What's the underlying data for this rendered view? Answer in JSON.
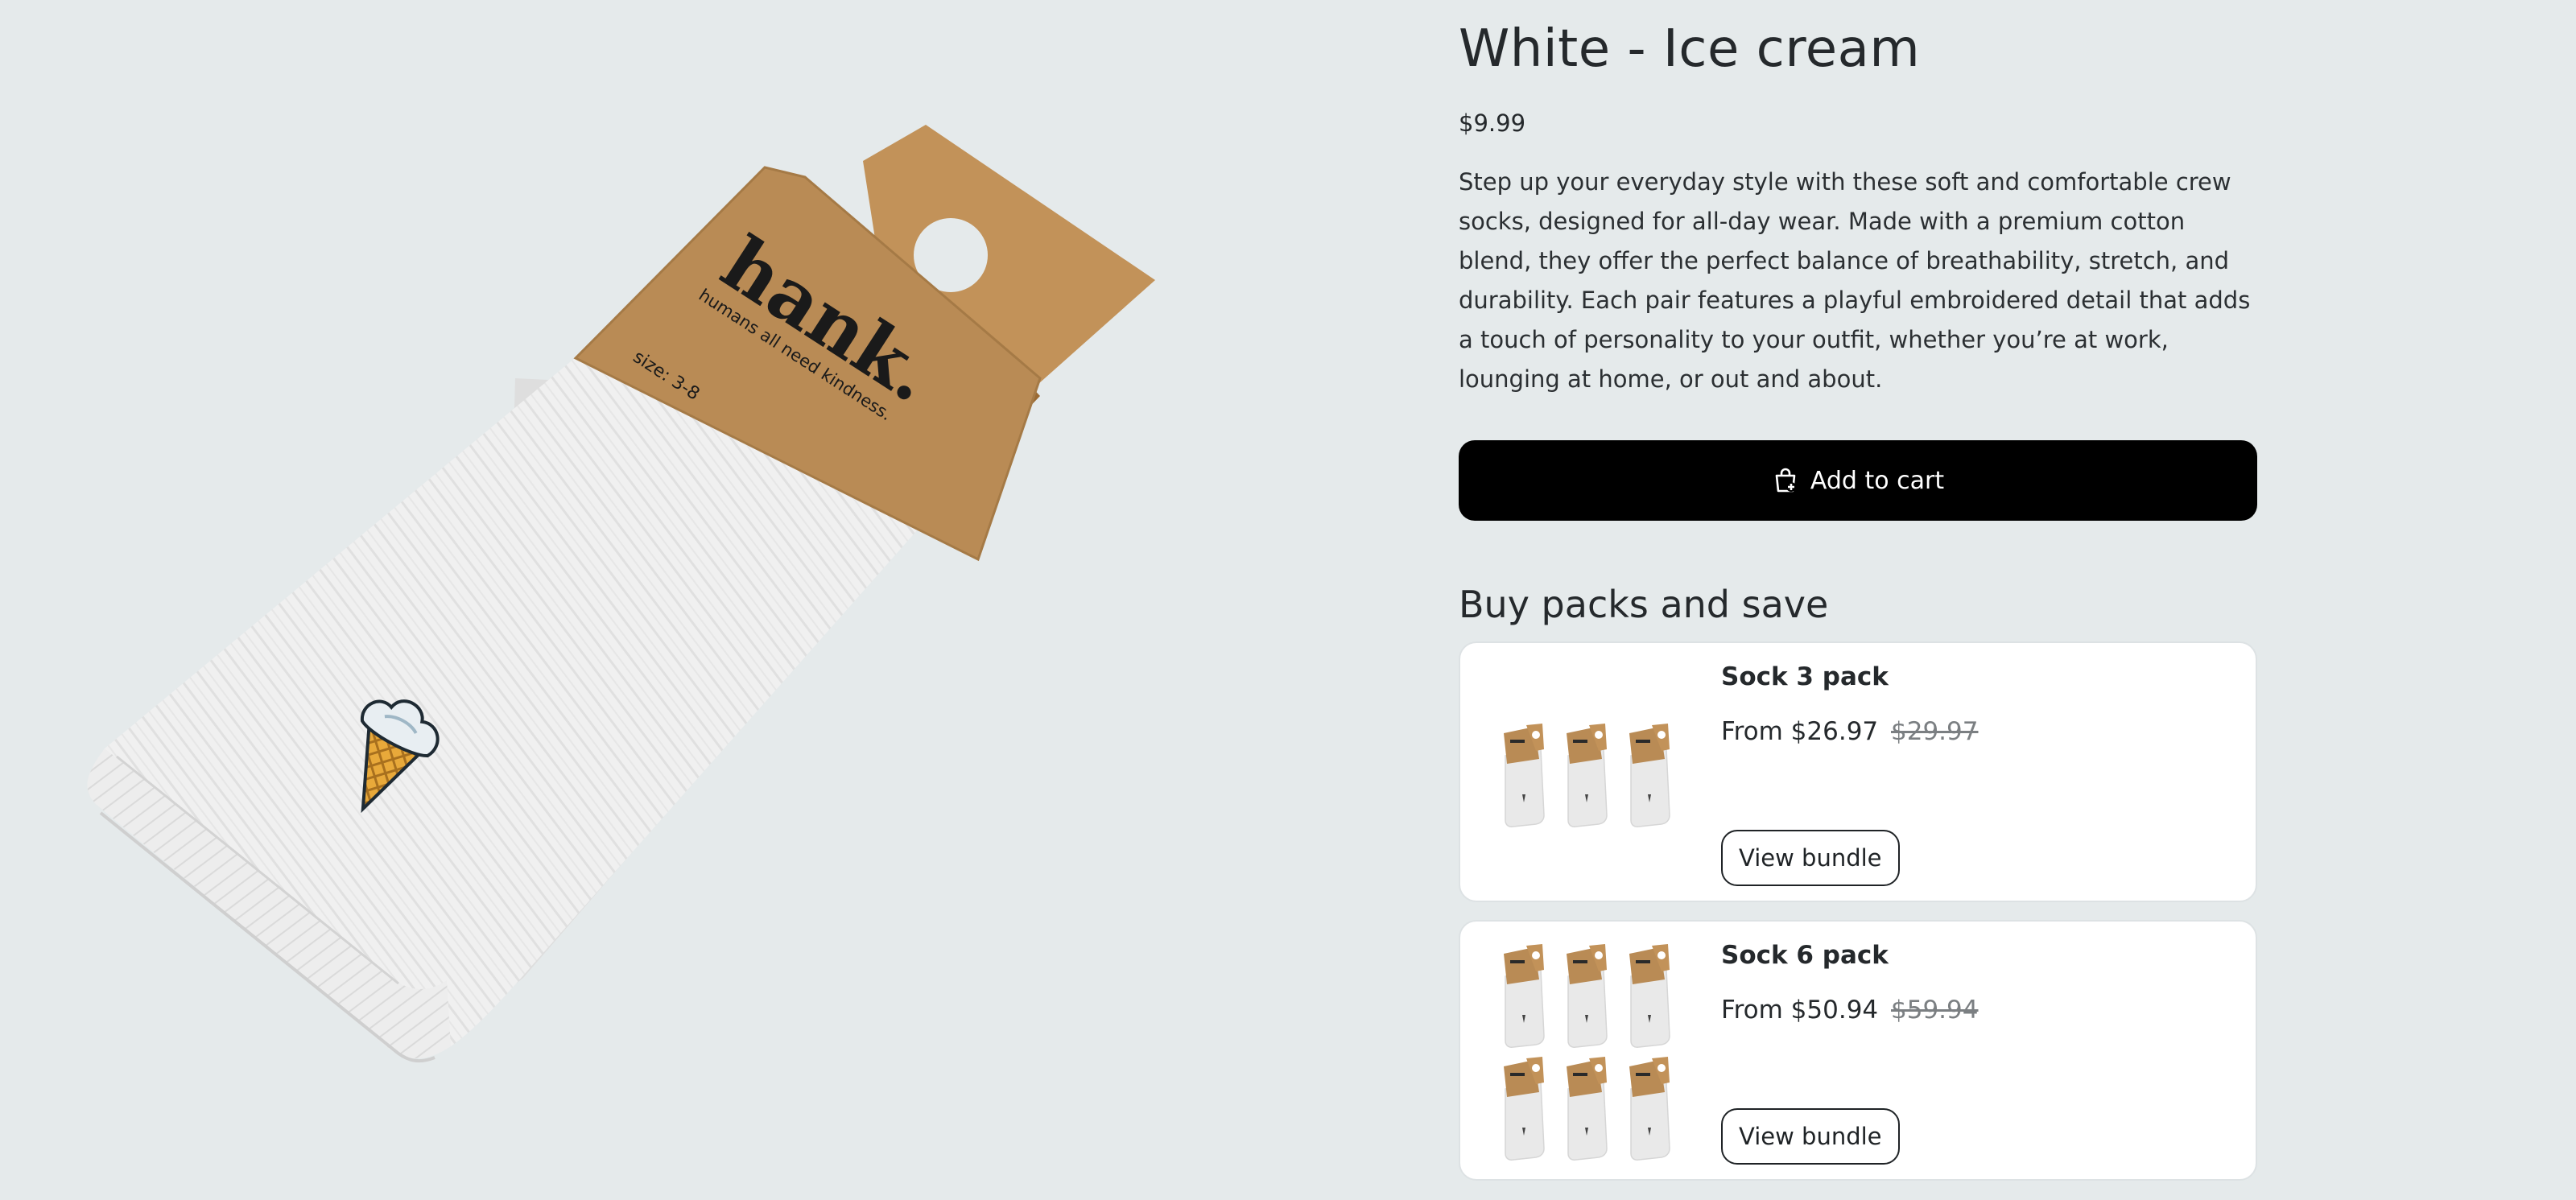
{
  "product": {
    "title": "White - Ice cream",
    "price": "$9.99",
    "description": "Step up your everyday style with these soft and comfortable crew socks, designed for all-day wear. Made with a premium cotton blend, they offer the perfect balance of breathability, stretch, and durability. Each pair features a playful embroidered detail that adds a touch of personality to your outfit, whether you’re at work, lounging at home, or out and about.",
    "add_to_cart_label": "Add to cart",
    "add_to_cart_icon": "shopping-bag-icon",
    "image": {
      "brand": "hank.",
      "tagline": "humans all need kindness.",
      "size_label": "size: 3-8",
      "embroidery": "ice-cream-cone"
    }
  },
  "bundles_section": {
    "title": "Buy packs and save",
    "bundles": [
      {
        "name": "Sock 3 pack",
        "price_prefix": "From",
        "price": "$26.97",
        "compare_at_price": "$29.97",
        "pack_count": 3,
        "button_label": "View bundle"
      },
      {
        "name": "Sock 6 pack",
        "price_prefix": "From",
        "price": "$50.94",
        "compare_at_price": "$59.94",
        "pack_count": 6,
        "button_label": "View bundle"
      }
    ]
  },
  "colors": {
    "page_background": "#e5eaeb",
    "primary_button": "#000000",
    "kraft_card": "#b98d55",
    "strikethrough_price": "#7b7f82"
  }
}
